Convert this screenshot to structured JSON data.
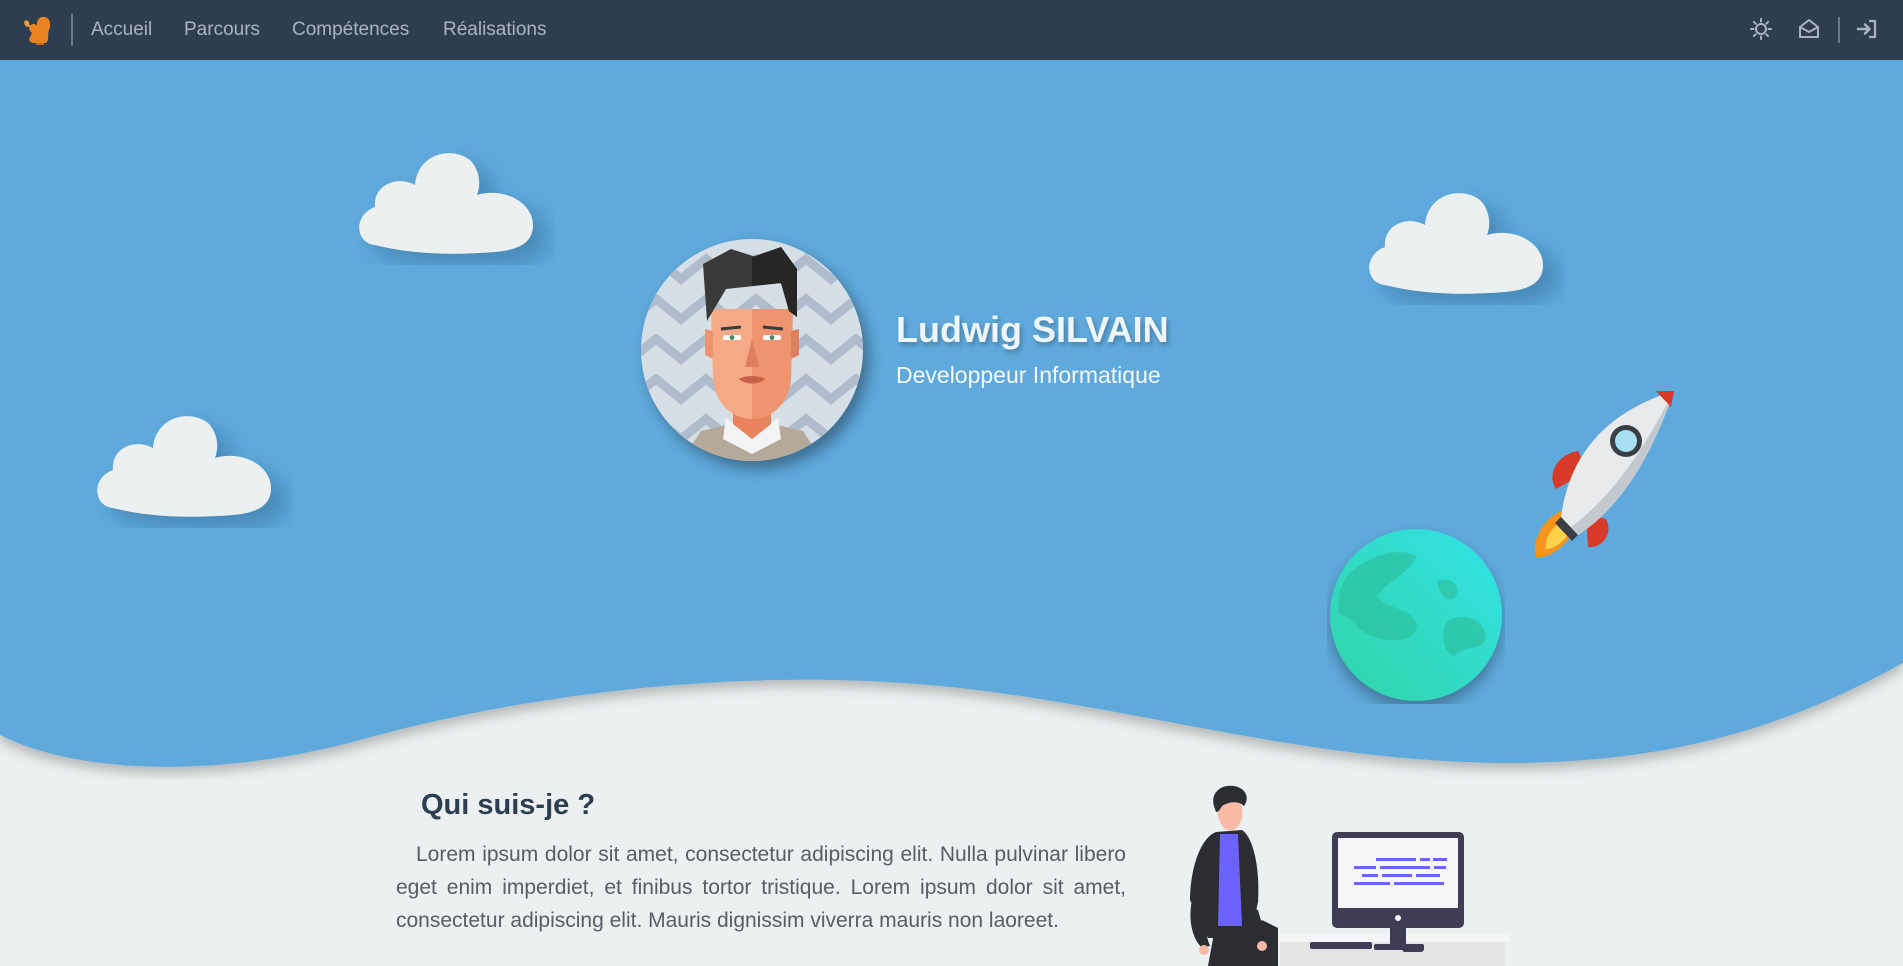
{
  "nav": {
    "brand_icon": "squirrel-logo",
    "links": [
      "Accueil",
      "Parcours",
      "Compétences",
      "Réalisations"
    ],
    "icons": [
      "theme-toggle-icon",
      "mail-icon",
      "login-icon"
    ]
  },
  "hero": {
    "name": "Ludwig SILVAIN",
    "title": "Developpeur Informatique"
  },
  "about": {
    "title": "Qui suis-je ?",
    "text": "Lorem ipsum dolor sit amet, consectetur adipiscing elit. Nulla pulvinar libero eget enim imperdiet, et finibus tortor tristique. Lorem ipsum dolor sit amet, consectetur adipiscing elit. Mauris dignissim viverra mauris non laoreet."
  },
  "colors": {
    "navbar": "#2e3e50",
    "hero_sky": "#5ea9dc",
    "page_bg": "#ecf0f1",
    "nav_link": "#a9b4bf",
    "heading": "#2c3e50"
  }
}
